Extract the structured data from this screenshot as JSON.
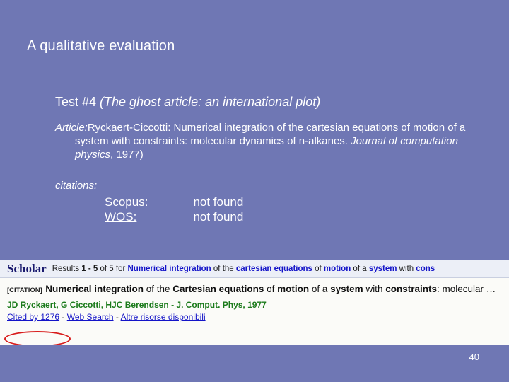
{
  "slide": {
    "title": "A qualitative evaluation",
    "page_number": "40",
    "test_line": {
      "prefix": "Test #4 ",
      "italic": "(The ghost article: an international plot)"
    },
    "article": {
      "label_italic": "Article:",
      "text_1": "Ryckaert-Ciccotti: Numerical integration of the cartesian equations of motion of a system with constraints: molecular dynamics of n-alkanes. ",
      "journal_italic": "Journal of computation physics",
      "text_2": ", 1977)"
    },
    "citations_label": "citations:",
    "citations": [
      {
        "source": "Scopus:",
        "result": "not found"
      },
      {
        "source": "WOS:",
        "result": "not found"
      }
    ]
  },
  "scholar": {
    "logo": "Scholar",
    "results_prefix": "Results ",
    "results_range": "1 - 5",
    "results_of": " of 5 for ",
    "query_terms": [
      "Numerical",
      "integration",
      "cartesian",
      "equations",
      "motion",
      "system",
      "cons"
    ],
    "results_line_plain": [
      " of the ",
      " of ",
      " of a ",
      " with "
    ],
    "citation_tag": "[CITATION]",
    "result_title_parts": {
      "a": "Numerical integration",
      "b": " of the ",
      "c": "Cartesian equations",
      "d": " of ",
      "e": "motion",
      "f": " of a ",
      "g": "system",
      "h": " with ",
      "i": "constraints",
      "j": ": molecular …"
    },
    "authors": "JD Ryckaert, G Ciccotti, HJC Berendsen - J. Comput. Phys, 1977",
    "links": {
      "cited_by": "Cited by 1276",
      "web_search": "Web Search",
      "altre": "Altre risorse disponibili"
    }
  },
  "colors": {
    "background": "#6f77b4",
    "title_text": "#ffffff",
    "scholar_bg": "#fbfbf8",
    "link_blue": "#1414c8",
    "highlight_red": "#d81c1c"
  }
}
